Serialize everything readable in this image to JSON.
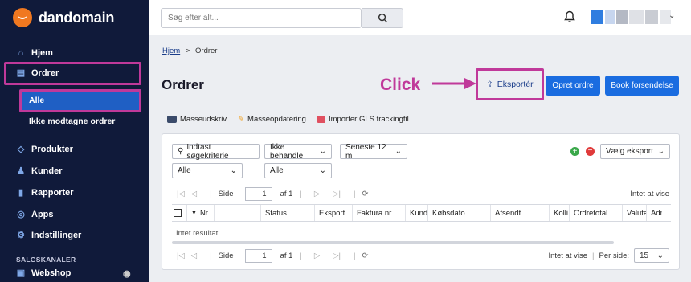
{
  "brand": {
    "name": "dandomain",
    "color": "#f07820"
  },
  "sidebar": {
    "items": [
      {
        "label": "Hjem",
        "icon": "home-icon"
      },
      {
        "label": "Ordrer",
        "icon": "orders-icon"
      },
      {
        "label": "Produkter",
        "icon": "tag-icon"
      },
      {
        "label": "Kunder",
        "icon": "users-icon"
      },
      {
        "label": "Rapporter",
        "icon": "chart-icon"
      },
      {
        "label": "Apps",
        "icon": "apps-icon"
      },
      {
        "label": "Indstillinger",
        "icon": "settings-icon"
      }
    ],
    "subitems": [
      {
        "label": "Alle"
      },
      {
        "label": "Ikke modtagne ordrer"
      }
    ],
    "section_label": "SALGSKANALER",
    "channel": {
      "label": "Webshop",
      "icon": "eye-icon"
    }
  },
  "topbar": {
    "search_placeholder": "Søg efter alt..."
  },
  "breadcrumb": {
    "home": "Hjem",
    "separator": ">",
    "current": "Ordrer"
  },
  "page": {
    "title": "Ordrer"
  },
  "annotation": {
    "text": "Click",
    "color": "#c0399a"
  },
  "actions": {
    "export": "Eksportér",
    "create_order": "Opret ordre",
    "book_shipment": "Book forsendelse"
  },
  "tools": {
    "print": "Masseudskriv",
    "update": "Masseopdatering",
    "import": "Importer GLS trackingfil"
  },
  "filters": {
    "search": "Indtast søgekriterie",
    "status_filter": "Ikke behandle",
    "period": "Seneste 12 m",
    "select1": "Alle",
    "select2": "Alle",
    "export_select": "Vælg eksport"
  },
  "pager": {
    "label": "Side",
    "page": "1",
    "of": "af 1",
    "info": "Intet at vise",
    "per_page_label": "Per side:",
    "per_page": "15"
  },
  "table": {
    "columns": [
      "Nr.",
      "Status",
      "Eksport",
      "Faktura nr.",
      "Kunde",
      "Købsdato",
      "Afsendt",
      "Kolli",
      "Ordretotal",
      "Valuta",
      "Adm"
    ],
    "empty": "Intet resultat"
  }
}
